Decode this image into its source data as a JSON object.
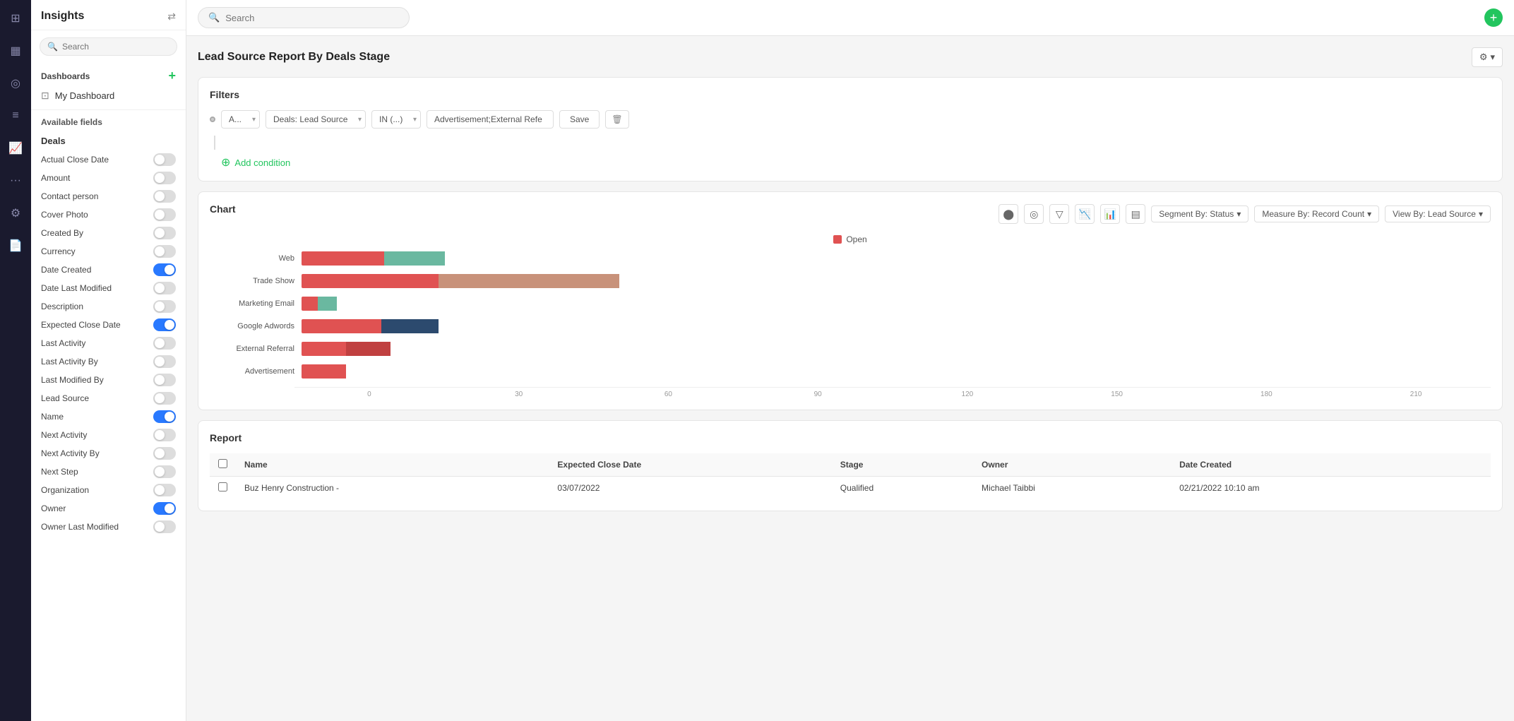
{
  "iconbar": {
    "icons": [
      {
        "name": "grid-icon",
        "symbol": "⊞",
        "active": false
      },
      {
        "name": "chart-icon",
        "symbol": "📊",
        "active": false
      },
      {
        "name": "dollar-icon",
        "symbol": "◎",
        "active": false
      },
      {
        "name": "list-icon",
        "symbol": "☰",
        "active": false
      },
      {
        "name": "analytics-icon",
        "symbol": "📈",
        "active": true
      },
      {
        "name": "more-icon",
        "symbol": "···",
        "active": false
      },
      {
        "name": "settings-icon",
        "symbol": "⚙",
        "active": false
      },
      {
        "name": "docs-icon",
        "symbol": "📄",
        "active": false
      }
    ]
  },
  "sidebar": {
    "title": "Insights",
    "filter_icon": "⇄",
    "search_placeholder": "Search",
    "dashboards_label": "Dashboards",
    "my_dashboard": "My Dashboard",
    "my_dashboard_icon": "⊡",
    "available_fields_label": "Available fields",
    "deals_label": "Deals",
    "fields": [
      {
        "name": "Actual Close Date",
        "on": false
      },
      {
        "name": "Amount",
        "on": false
      },
      {
        "name": "Contact person",
        "on": false
      },
      {
        "name": "Cover Photo",
        "on": false
      },
      {
        "name": "Created By",
        "on": false
      },
      {
        "name": "Currency",
        "on": false
      },
      {
        "name": "Date Created",
        "on": true
      },
      {
        "name": "Date Last Modified",
        "on": false
      },
      {
        "name": "Description",
        "on": false
      },
      {
        "name": "Expected Close Date",
        "on": true
      },
      {
        "name": "Last Activity",
        "on": false
      },
      {
        "name": "Last Activity By",
        "on": false
      },
      {
        "name": "Last Modified By",
        "on": false
      },
      {
        "name": "Lead Source",
        "on": false
      },
      {
        "name": "Name",
        "on": true
      },
      {
        "name": "Next Activity",
        "on": false
      },
      {
        "name": "Next Activity By",
        "on": false
      },
      {
        "name": "Next Step",
        "on": false
      },
      {
        "name": "Organization",
        "on": false
      },
      {
        "name": "Owner",
        "on": true
      },
      {
        "name": "Owner Last Modified",
        "on": false
      }
    ]
  },
  "topbar": {
    "search_placeholder": "Search",
    "add_icon": "+"
  },
  "report": {
    "title": "Lead Source Report By Deals Stage",
    "settings_label": "⚙ ▾"
  },
  "filters": {
    "section_title": "Filters",
    "condition_type": "A...",
    "field": "Deals: Lead Source",
    "operator": "IN (...)",
    "value": "Advertisement;External Refe",
    "save_btn": "Save",
    "delete_btn": "🗑",
    "add_condition_label": "Add condition"
  },
  "chart": {
    "section_title": "Chart",
    "segment_by_label": "Segment By: Status",
    "measure_by_label": "Measure By: Record Count",
    "view_by_label": "View By: Lead Source",
    "legend": [
      {
        "label": "Open",
        "color": "#e05252"
      }
    ],
    "bars": [
      {
        "label": "Web",
        "segments": [
          {
            "color": "#e05252",
            "width_pct": 26
          },
          {
            "color": "#6ab8a0",
            "width_pct": 19
          }
        ]
      },
      {
        "label": "Trade Show",
        "segments": [
          {
            "color": "#e05252",
            "width_pct": 43
          },
          {
            "color": "#c8927a",
            "width_pct": 57
          }
        ]
      },
      {
        "label": "Marketing Email",
        "segments": [
          {
            "color": "#e05252",
            "width_pct": 5
          },
          {
            "color": "#6ab8a0",
            "width_pct": 6
          }
        ]
      },
      {
        "label": "Google Adwords",
        "segments": [
          {
            "color": "#e05252",
            "width_pct": 25
          },
          {
            "color": "#2c4a6e",
            "width_pct": 18
          }
        ]
      },
      {
        "label": "External Referral",
        "segments": [
          {
            "color": "#e05252",
            "width_pct": 14
          },
          {
            "color": "#c04040",
            "width_pct": 14
          }
        ]
      },
      {
        "label": "Advertisement",
        "segments": [
          {
            "color": "#e05252",
            "width_pct": 14
          },
          {
            "color": "#e05252",
            "width_pct": 0
          }
        ]
      }
    ],
    "axis_ticks": [
      "0",
      "30",
      "60",
      "90",
      "120",
      "150",
      "180",
      "210"
    ]
  },
  "report_table": {
    "section_title": "Report",
    "columns": [
      "Name",
      "Expected Close Date",
      "Stage",
      "Owner",
      "Date Created"
    ],
    "rows": [
      {
        "name": "Buz Henry Construction -",
        "expected_close": "03/07/2022",
        "stage": "Qualified",
        "owner": "Michael Taibbi",
        "date_created": "02/21/2022 10:10 am"
      }
    ]
  }
}
